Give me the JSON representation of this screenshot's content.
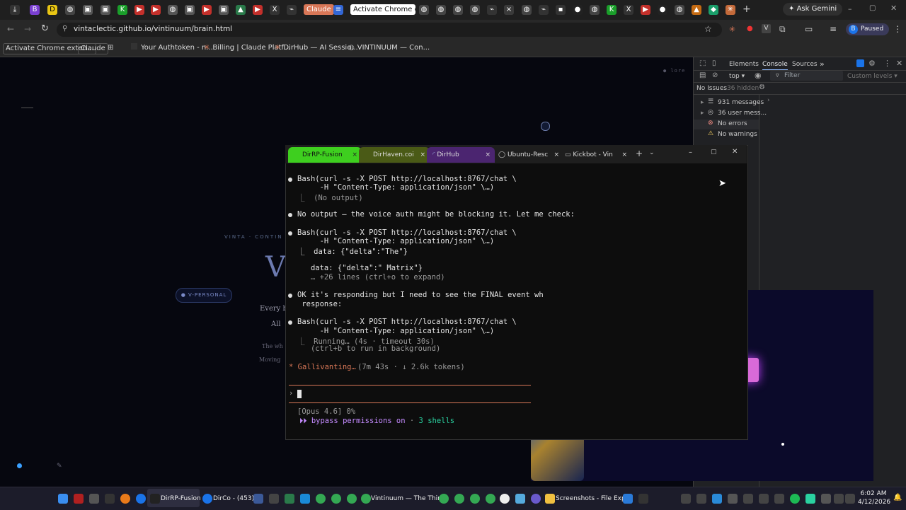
{
  "browser": {
    "tab_pill_claude": "Claude",
    "tab_pill_activate": "Activate Chrome exte",
    "url": "vintaclectic.github.io/vintinuum/brain.html",
    "ask_gemini": "Ask Gemini",
    "profile_initial": "B",
    "profile_status": "Paused",
    "new_tab": "+",
    "bookmarks": [
      {
        "label": "Activate Chrome exten..."
      },
      {
        "label": "Claude"
      },
      {
        "label": "Your Authtoken - n..."
      },
      {
        "label": "Billing | Claude Platf..."
      },
      {
        "label": "DirHub — AI Sessio..."
      },
      {
        "label": "VINTINUUM — Con..."
      }
    ]
  },
  "page": {
    "corner_label": "● lore",
    "subtitle": "VINTA · CONTIN",
    "big_letter": "V",
    "badge": "● V-PERSONAL",
    "line1": "Every b",
    "line2": "All",
    "line3": "The wh",
    "line4": "Moving"
  },
  "devtools": {
    "tabs": [
      "Elements",
      "Console",
      "Sources"
    ],
    "more": "»",
    "context": "top",
    "filter_placeholder": "Filter",
    "levels": "Custom levels",
    "issues": "No Issues",
    "hidden": "36 hidden",
    "sidebar": [
      {
        "label": "931 messages",
        "icon": "list-icon"
      },
      {
        "label": "36 user mess...",
        "icon": "user-icon"
      },
      {
        "label": "No errors",
        "icon": "error-icon"
      },
      {
        "label": "No warnings",
        "icon": "warning-icon"
      }
    ]
  },
  "terminal": {
    "tabs": [
      {
        "label": "DirRP-Fusion",
        "color": "#3ecf1f"
      },
      {
        "label": "DirHaven.coi",
        "color": "#4a5a16"
      },
      {
        "label": "DirHub",
        "color": "#4b2570"
      },
      {
        "label": "Ubuntu-Resc",
        "color": "#1e1e1e"
      },
      {
        "label": "Kickbot - Vin",
        "color": "#1e1e1e"
      }
    ],
    "new_tab": "+",
    "lines": {
      "b1": "Bash(curl -s -X POST http://localhost:8767/chat \\",
      "b1c": "     -H \"Content-Type: application/json\" \\…)",
      "b1o": "⎿  (No output)",
      "m1": "No output — the voice auth might be blocking it. Let me check:",
      "b2": "Bash(curl -s -X POST http://localhost:8767/chat \\",
      "b2c": "     -H \"Content-Type: application/json\" \\…)",
      "b2o1": "⎿  data: {\"delta\":\"The\"}",
      "b2o2": "   data: {\"delta\":\" Matrix\"}",
      "b2o3": "   … +26 lines (ctrl+o to expand)",
      "m2": "OK it's responding but I need to see the FINAL event wh",
      "m2c": " response:",
      "b3": "Bash(curl -s -X POST http://localhost:8767/chat \\",
      "b3c": "     -H \"Content-Type: application/json\" \\…)",
      "b3o1": "⎿  Running… (4s · timeout 30s)",
      "b3o2": "   (ctrl+b to run in background)",
      "status_word": "* Gallivanting…",
      "status_meta": "(7m 43s · ↓ 2.6k tokens)",
      "prompt": "›",
      "model": "[Opus 4.6] 0%",
      "mode_prefix": "⏵⏵ bypass permissions on",
      "mode_sep": " · ",
      "shells": "3 shells"
    }
  },
  "taskbar": {
    "items": [
      {
        "label": "DirRP-Fusion"
      },
      {
        "label": "DirCo - (453)"
      },
      {
        "label": "Vintinuum — The Thing"
      },
      {
        "label": "Screenshots - File Explo"
      }
    ],
    "time": "6:02 AM",
    "date": "4/12/2026"
  },
  "colors": {
    "accent_green": "#3ecf1f",
    "claude_orange": "#d97757",
    "shells_green": "#2ad1a0",
    "mode_purple": "#c48bff"
  }
}
